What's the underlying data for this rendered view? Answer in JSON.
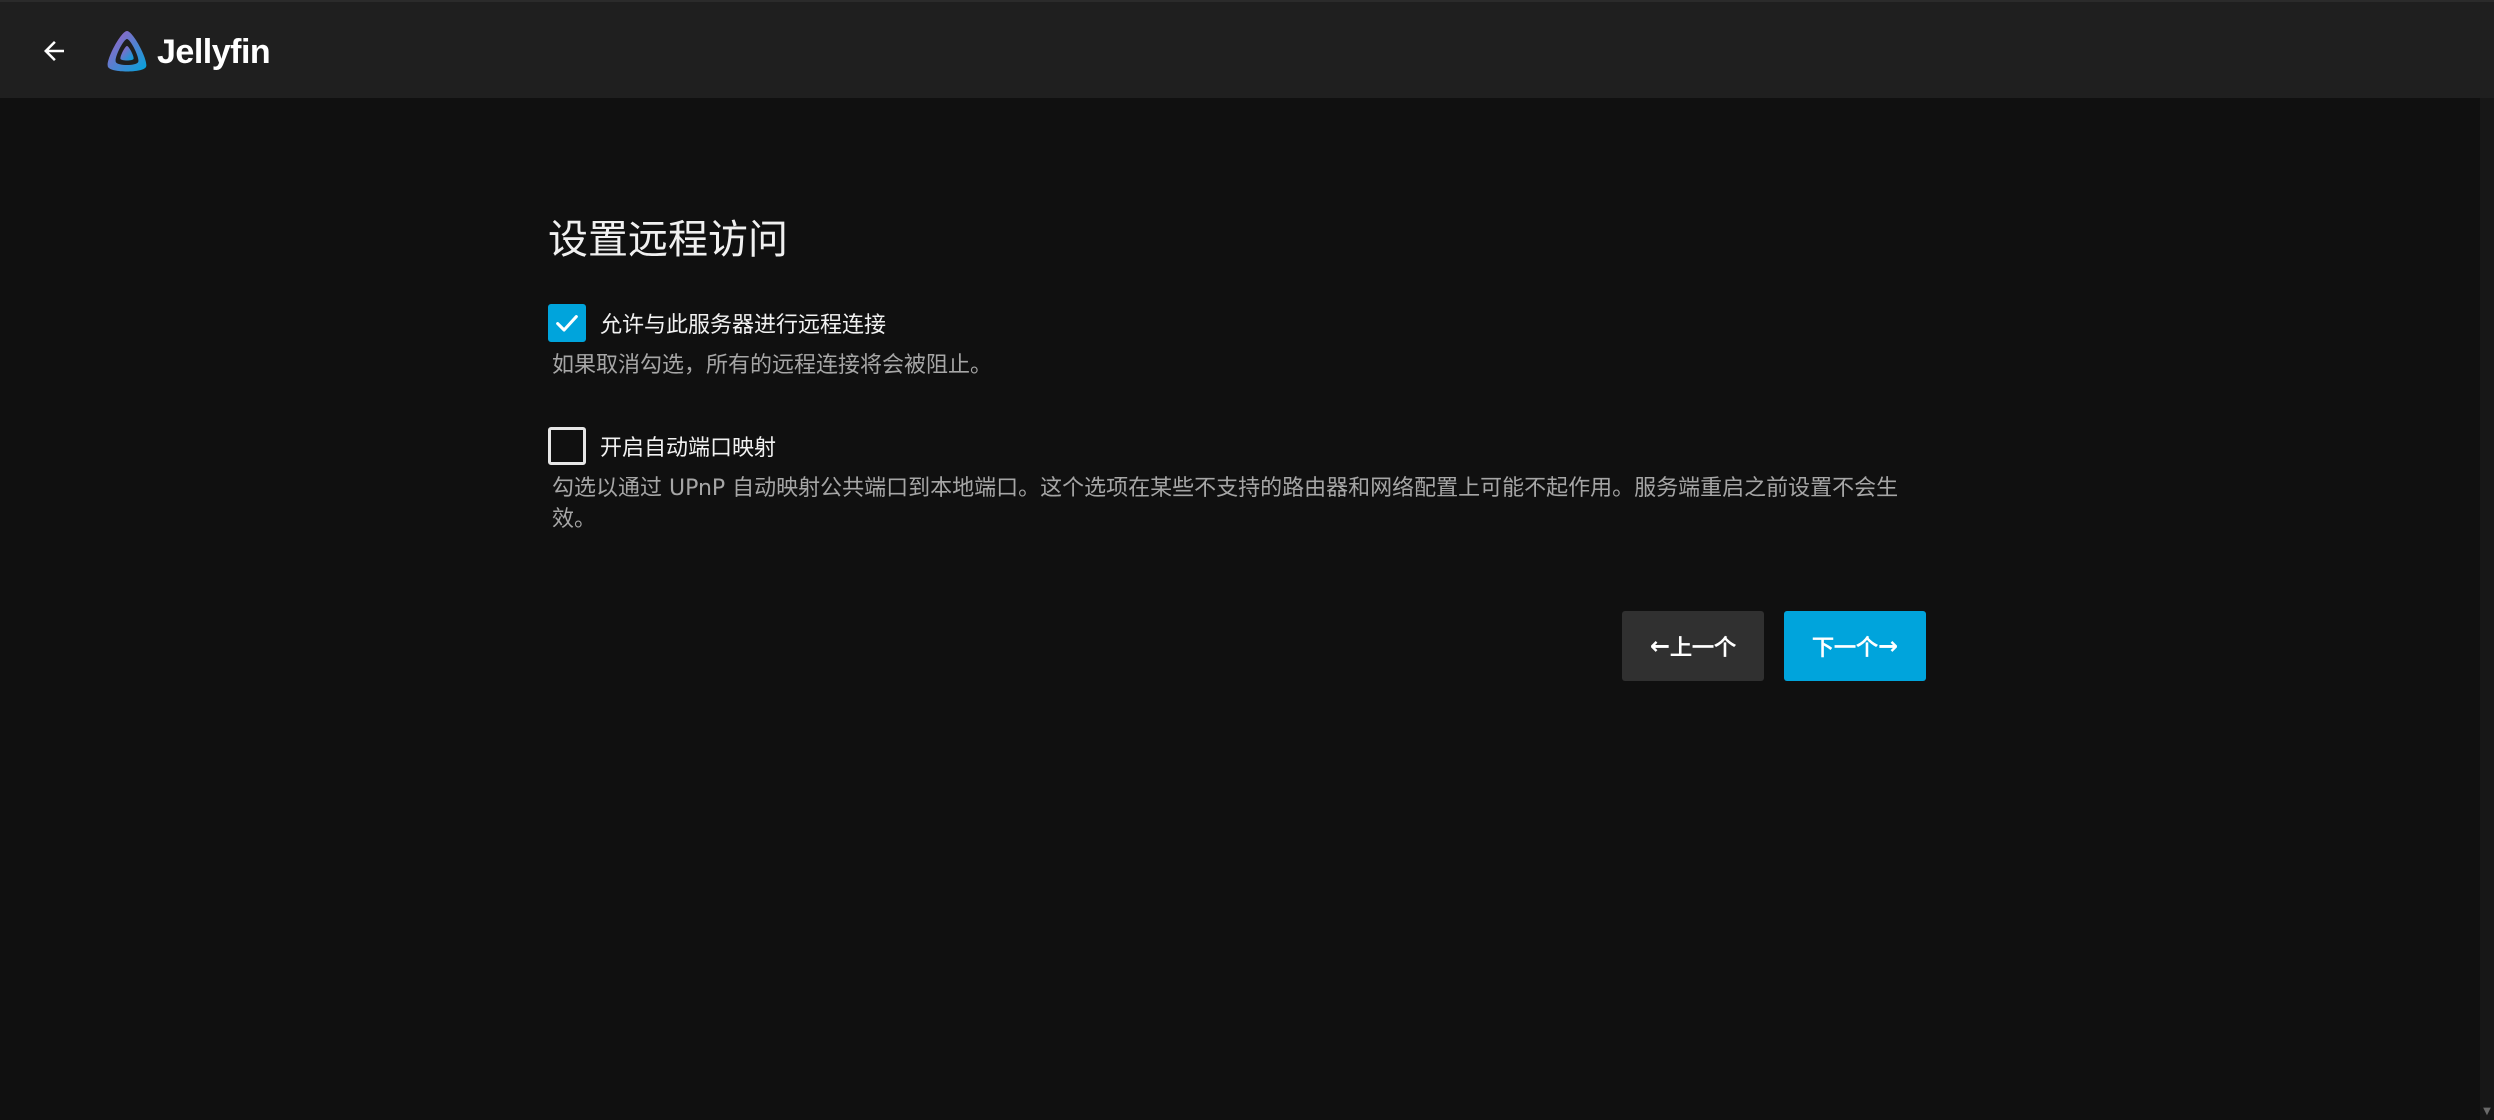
{
  "header": {
    "logo_text": "Jellyfin",
    "back_icon": "arrow-left-icon"
  },
  "main": {
    "title": "设置远程访问",
    "remote_access": {
      "label": "允许与此服务器进行远程连接",
      "checked": true,
      "help": "如果取消勾选，所有的远程连接将会被阻止。"
    },
    "upnp": {
      "label": "开启自动端口映射",
      "checked": false,
      "help": "勾选以通过 UPnP 自动映射公共端口到本地端口。这个选项在某些不支持的路由器和网络配置上可能不起作用。服务端重启之前设置不会生效。"
    }
  },
  "buttons": {
    "prev_label": "上一个",
    "next_label": "下一个",
    "prev_arrow": "←",
    "next_arrow": "→"
  },
  "colors": {
    "accent": "#00a4dc",
    "background": "#101010",
    "header": "#1f1f1f",
    "secondary_button": "#303030"
  }
}
